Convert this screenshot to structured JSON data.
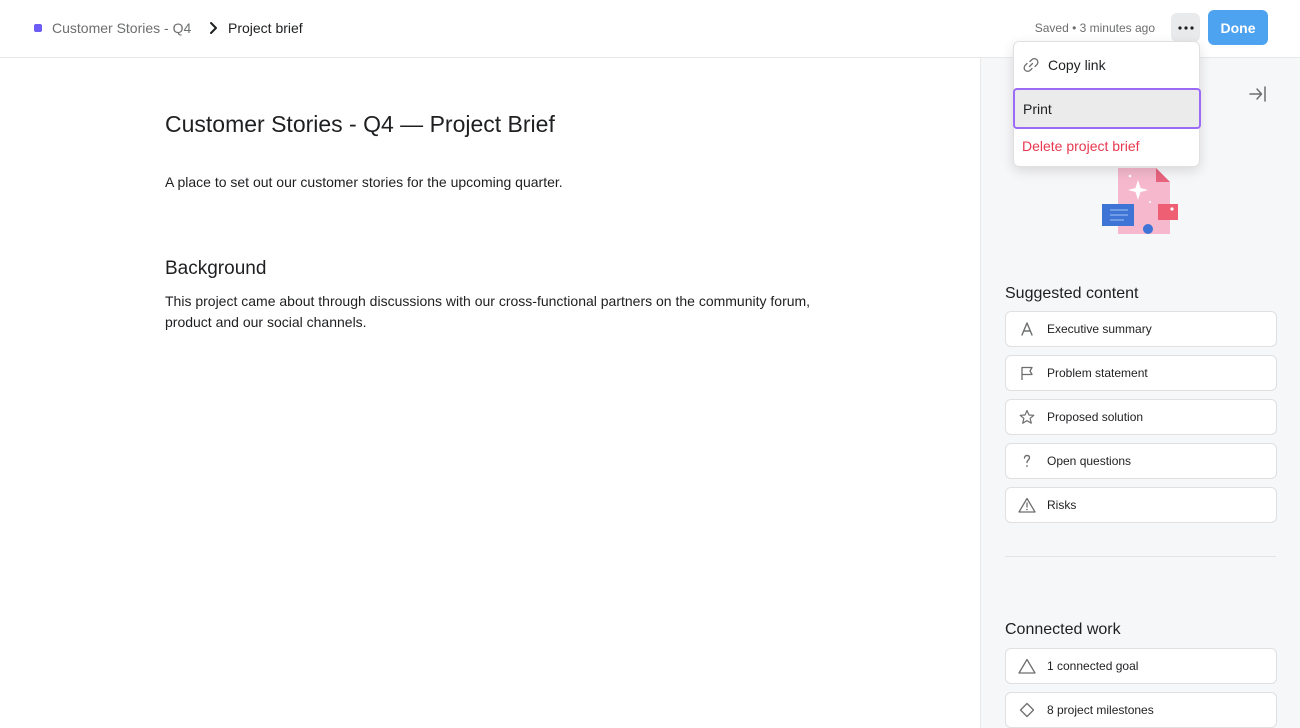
{
  "header": {
    "breadcrumb": {
      "project": "Customer Stories - Q4",
      "page": "Project brief",
      "project_color": "#6e5cf6"
    },
    "status": "Saved • 3 minutes ago",
    "more_icon": "more-horizontal-icon",
    "done_label": "Done"
  },
  "menu": {
    "items": [
      {
        "label": "Copy link",
        "icon": "link-icon"
      },
      {
        "label": "Print",
        "state": "hovered"
      },
      {
        "label": "Delete project brief",
        "color": "#e8384f"
      }
    ]
  },
  "document": {
    "title": "Customer Stories - Q4 — Project Brief",
    "intro": "A place to set out our customer stories for the upcoming quarter.",
    "sections": [
      {
        "heading": "Background",
        "body": "This project came about through discussions with our cross-functional partners on the community forum, product and our social channels."
      }
    ]
  },
  "sidepanel": {
    "collapse_icon": "collapse-right-icon",
    "suggested": {
      "heading": "Suggested content",
      "items": [
        {
          "label": "Executive summary",
          "icon": "text-a-icon"
        },
        {
          "label": "Problem statement",
          "icon": "flag-icon"
        },
        {
          "label": "Proposed solution",
          "icon": "star-icon"
        },
        {
          "label": "Open questions",
          "icon": "question-icon"
        },
        {
          "label": "Risks",
          "icon": "warning-icon"
        }
      ]
    },
    "connected": {
      "heading": "Connected work",
      "items": [
        {
          "label": "1 connected goal",
          "icon": "goal-triangle-icon"
        },
        {
          "label": "8 project milestones",
          "icon": "milestone-diamond-icon"
        }
      ]
    }
  },
  "colors": {
    "accent": "#4da3f0",
    "danger": "#e8384f",
    "focus_ring": "#9b6af6"
  }
}
